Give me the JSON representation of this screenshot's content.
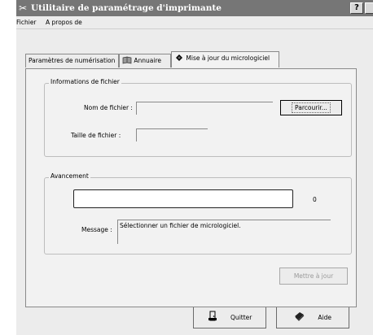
{
  "window": {
    "title": "Utilitaire de paramétrage d'imprimante",
    "help_button": "?",
    "colors": {
      "titlebar": "#767676",
      "face": "#ececec",
      "disabled_text": "#9a9a9a"
    }
  },
  "menu": {
    "items": [
      {
        "label": "Fichier"
      },
      {
        "label": "A propos de"
      }
    ]
  },
  "tabs": [
    {
      "label": "Paramètres de numérisation",
      "icon": "",
      "active": false
    },
    {
      "label": "Annuaire",
      "icon": "address-book-icon",
      "active": false
    },
    {
      "label": "Mise à jour du micrologiciel",
      "icon": "firmware-chip-icon",
      "active": true
    }
  ],
  "file_info": {
    "legend": "Informations de fichier",
    "filename_label": "Nom de fichier :",
    "filename_value": "",
    "browse_button": "Parcourir...",
    "filesize_label": "Taille de fichier :",
    "filesize_value": ""
  },
  "progress": {
    "legend": "Avancement",
    "value_text": "0",
    "fraction": 0,
    "message_label": "Message :",
    "message_text": "Sélectionner un fichier de micrologiciel."
  },
  "update_button": {
    "label": "Mettre à jour",
    "enabled": false
  },
  "footer": {
    "quit_button": {
      "label": "Quitter",
      "icon": "exit-door-icon"
    },
    "help_button": {
      "label": "Aide",
      "icon": "help-book-icon"
    }
  }
}
